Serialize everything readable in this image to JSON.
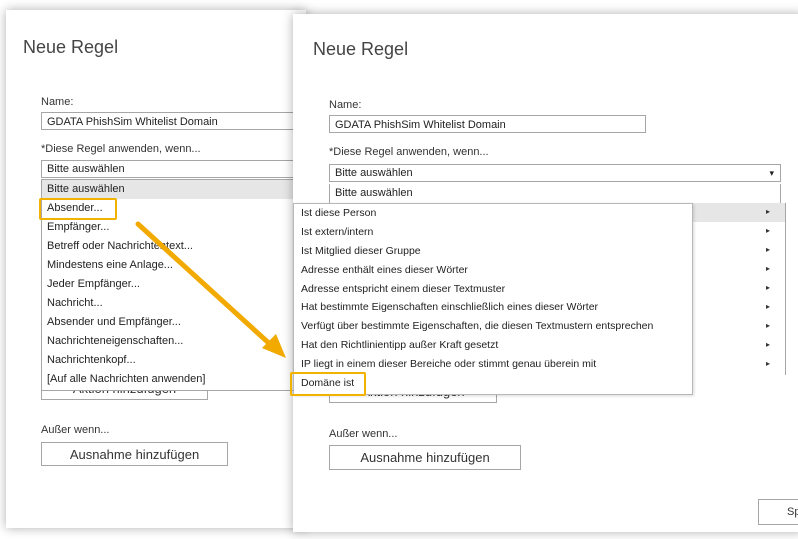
{
  "left": {
    "title": "Neue Regel",
    "name_label": "Name:",
    "name_value": "GDATA PhishSim Whitelist Domain",
    "apply_label": "*Diese Regel anwenden, wenn...",
    "select_value": "Bitte auswählen",
    "dropdown_items": [
      "Bitte auswählen",
      "Absender...",
      "Empfänger...",
      "Betreff oder Nachrichtentext...",
      "Mindestens eine Anlage...",
      "Jeder Empfänger...",
      "Nachricht...",
      "Absender und Empfänger...",
      "Nachrichteneigenschaften...",
      "Nachrichtenkopf...",
      "[Auf alle Nachrichten anwenden]"
    ],
    "action_button": "Aktion hinzufügen",
    "except_label": "Außer wenn...",
    "exception_button": "Ausnahme hinzufügen"
  },
  "right": {
    "title": "Neue Regel",
    "name_label": "Name:",
    "name_value": "GDATA PhishSim Whitelist Domain",
    "apply_label": "*Diese Regel anwenden, wenn...",
    "select_value": "Bitte auswählen",
    "dropdown_first": "Bitte auswählen",
    "action_button": "Aktion hinzufügen",
    "except_label": "Außer wenn...",
    "exception_button": "Ausnahme hinzufügen",
    "save_button_partial": "Sp"
  },
  "submenu": {
    "items": [
      "Ist diese Person",
      "Ist extern/intern",
      "Ist Mitglied dieser Gruppe",
      "Adresse enthält eines dieser Wörter",
      "Adresse entspricht einem dieser Textmuster",
      "Hat bestimmte Eigenschaften einschließlich eines dieser Wörter",
      "Verfügt über bestimmte Eigenschaften, die diesen Textmustern entsprechen",
      "Hat den Richtlinientipp außer Kraft gesetzt",
      "IP liegt in einem dieser Bereiche oder stimmt genau überein mit",
      "Domäne ist"
    ]
  },
  "icons": {
    "caret": "▾",
    "submenu_arrow": "▸"
  },
  "colors": {
    "highlight": "#f2b300",
    "arrow": "#f2a900",
    "selected_row": "#e6e6e6",
    "border": "#a6a6a6"
  }
}
